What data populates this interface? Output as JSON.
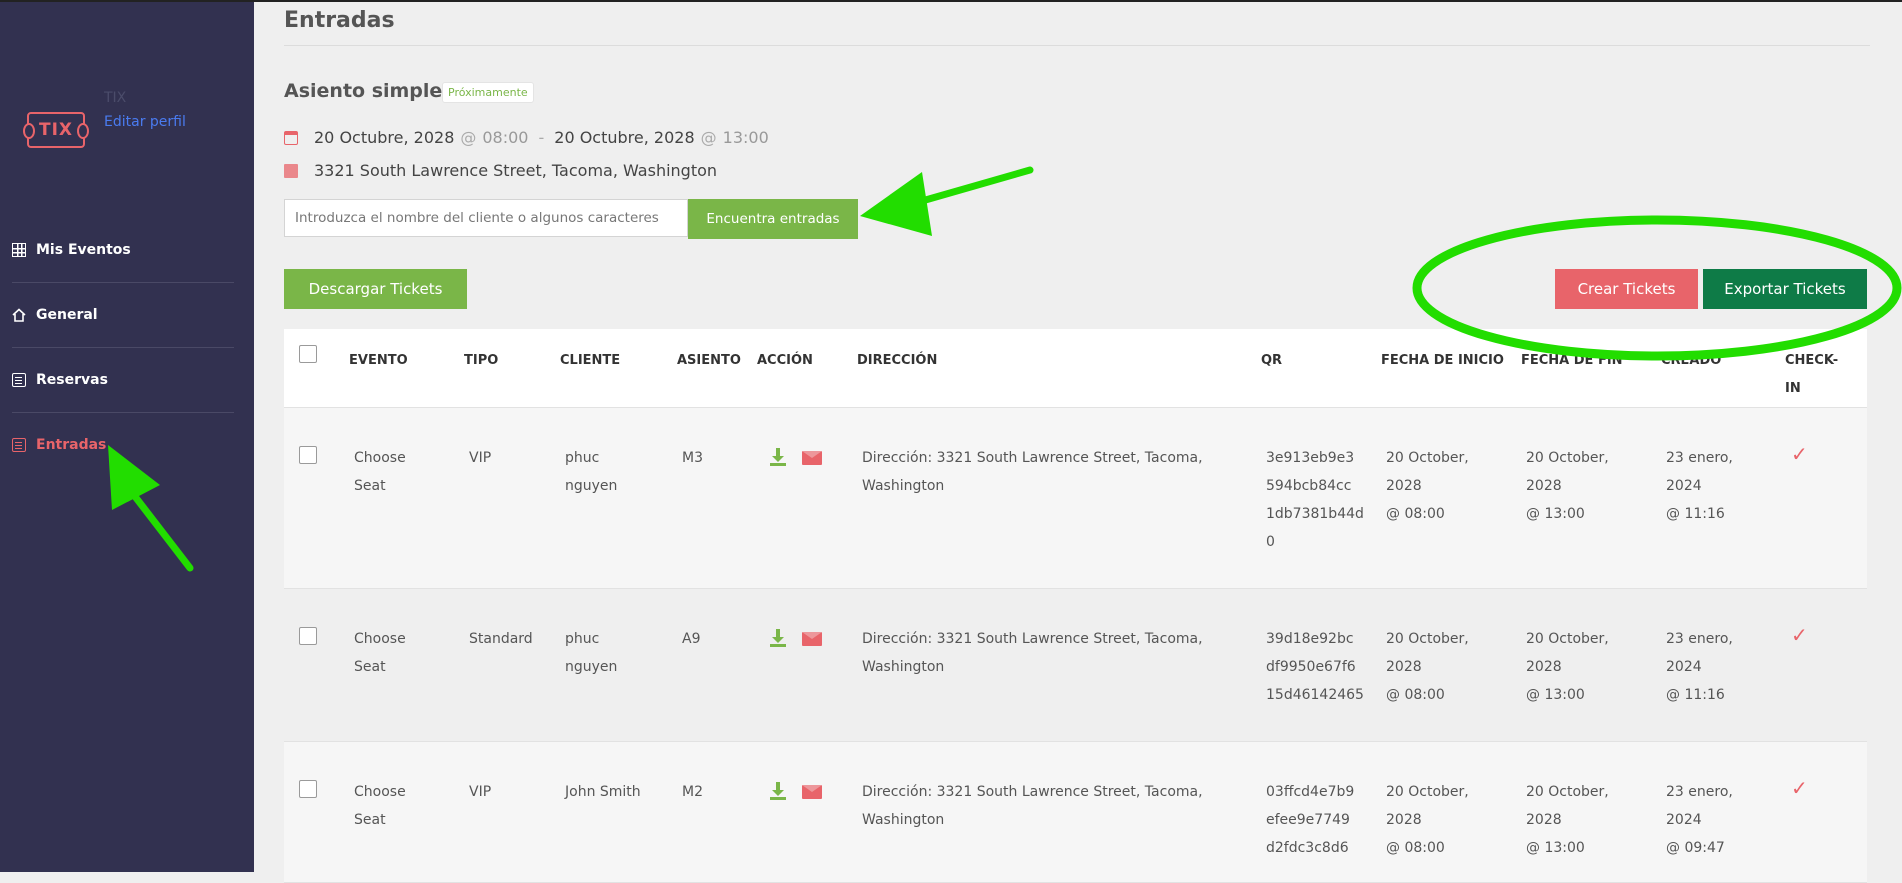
{
  "sidebar": {
    "brand": "TIX",
    "logo_text": "TIX",
    "edit_profile": "Editar perfil",
    "items": [
      {
        "label": "Mis Eventos",
        "icon": "grid-icon"
      },
      {
        "label": "General",
        "icon": "home-icon"
      },
      {
        "label": "Reservas",
        "icon": "list-icon"
      },
      {
        "label": "Entradas",
        "icon": "ticket-doc-icon",
        "active": true
      }
    ]
  },
  "page": {
    "title": "Entradas",
    "event_name": "Asiento simple",
    "badge": "Próximamente",
    "start_date": "20 Octubre, 2028",
    "start_time": "08:00",
    "end_date": "20 Octubre, 2028",
    "end_time": "13:00",
    "at_symbol": "@",
    "date_separator": "-",
    "address": "3321 South Lawrence Street, Tacoma, Washington"
  },
  "search": {
    "placeholder": "Introduzca el nombre del cliente o algunos caracteres",
    "button": "Encuentra entradas"
  },
  "actions": {
    "download": "Descargar Tickets",
    "create": "Crear Tickets",
    "export": "Exportar Tickets"
  },
  "table": {
    "headers": {
      "evento": "EVENTO",
      "tipo": "TIPO",
      "cliente": "CLIENTE",
      "asiento": "ASIENTO",
      "accion": "ACCIÓN",
      "direccion": "DIRECCIÓN",
      "qr": "QR",
      "fecha_inicio": "FECHA DE INICIO",
      "fecha_fin": "FECHA DE FIN",
      "creado": "CREADO",
      "check_in_1": "CHECK-",
      "check_in_2": "IN"
    },
    "rows": [
      {
        "evento": [
          "Choose",
          "Seat"
        ],
        "tipo": [
          "VIP"
        ],
        "cliente": [
          "phuc",
          "nguyen"
        ],
        "asiento": "M3",
        "direccion": [
          "Dirección: 3321 South Lawrence Street, Tacoma,",
          "Washington"
        ],
        "qr": [
          "3e913eb9e3",
          "594bcb84cc",
          "1db7381b44d",
          "0"
        ],
        "inicio": [
          "20 October,",
          "2028",
          "@ 08:00"
        ],
        "fin": [
          "20 October,",
          "2028",
          "@ 13:00"
        ],
        "creado": [
          "23 enero,",
          "2024",
          "@ 11:16"
        ],
        "checkin": "✓"
      },
      {
        "evento": [
          "Choose",
          "Seat"
        ],
        "tipo": [
          "Standard"
        ],
        "cliente": [
          "phuc",
          "nguyen"
        ],
        "asiento": "A9",
        "direccion": [
          "Dirección: 3321 South Lawrence Street, Tacoma,",
          "Washington"
        ],
        "qr": [
          "39d18e92bc",
          "df9950e67f6",
          "15d46142465"
        ],
        "inicio": [
          "20 October,",
          "2028",
          "@ 08:00"
        ],
        "fin": [
          "20 October,",
          "2028",
          "@ 13:00"
        ],
        "creado": [
          "23 enero,",
          "2024",
          "@ 11:16"
        ],
        "checkin": "✓"
      },
      {
        "evento": [
          "Choose",
          "Seat"
        ],
        "tipo": [
          "VIP"
        ],
        "cliente": [
          "John Smith"
        ],
        "asiento": "M2",
        "direccion": [
          "Dirección: 3321 South Lawrence Street, Tacoma,",
          "Washington"
        ],
        "qr": [
          "03ffcd4e7b9",
          "efee9e7749",
          "d2fdc3c8d6"
        ],
        "inicio": [
          "20 October,",
          "2028",
          "@ 08:00"
        ],
        "fin": [
          "20 October,",
          "2028",
          "@ 13:00"
        ],
        "creado": [
          "23 enero,",
          "2024",
          "@ 09:47"
        ],
        "checkin": "✓"
      }
    ]
  },
  "colors": {
    "sidebar_bg": "#323150",
    "accent_red": "#e8646a",
    "accent_green": "#7ab648",
    "export_green": "#0e7b47",
    "annotation_green": "#22dd00"
  }
}
